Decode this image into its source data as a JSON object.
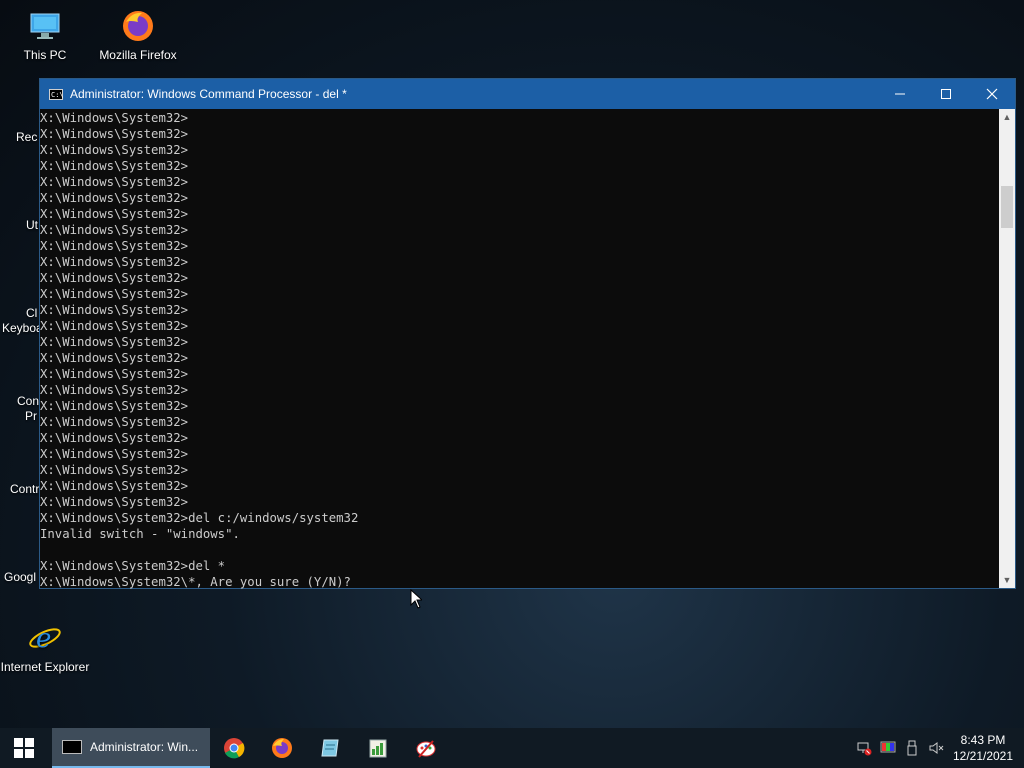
{
  "desktop": {
    "icons": [
      {
        "label": "This PC",
        "icon": "this-pc-icon"
      },
      {
        "label": "Mozilla Firefox",
        "icon": "firefox-icon"
      },
      {
        "label": "Internet Explorer",
        "icon": "internet-explorer-icon"
      }
    ],
    "partial_labels": [
      "Rec",
      "Ut",
      "Cl",
      "Keyboa",
      "Con",
      "Pr",
      "Contr",
      "Googl"
    ]
  },
  "window": {
    "title": "Administrator: Windows Command Processor - del  *",
    "minimize": "—",
    "maximize": "☐",
    "close": "✕"
  },
  "console": {
    "lines": [
      "X:\\Windows\\System32>",
      "X:\\Windows\\System32>",
      "X:\\Windows\\System32>",
      "X:\\Windows\\System32>",
      "X:\\Windows\\System32>",
      "X:\\Windows\\System32>",
      "X:\\Windows\\System32>",
      "X:\\Windows\\System32>",
      "X:\\Windows\\System32>",
      "X:\\Windows\\System32>",
      "X:\\Windows\\System32>",
      "X:\\Windows\\System32>",
      "X:\\Windows\\System32>",
      "X:\\Windows\\System32>",
      "X:\\Windows\\System32>",
      "X:\\Windows\\System32>",
      "X:\\Windows\\System32>",
      "X:\\Windows\\System32>",
      "X:\\Windows\\System32>",
      "X:\\Windows\\System32>",
      "X:\\Windows\\System32>",
      "X:\\Windows\\System32>",
      "X:\\Windows\\System32>",
      "X:\\Windows\\System32>",
      "X:\\Windows\\System32>",
      "X:\\Windows\\System32>del c:/windows/system32",
      "Invalid switch - \"windows\".",
      "",
      "X:\\Windows\\System32>del *",
      "X:\\Windows\\System32\\*, Are you sure (Y/N)?"
    ]
  },
  "taskbar": {
    "active_task": "Administrator: Win...",
    "pinned": [
      "chrome-icon",
      "firefox-icon",
      "notepad-icon",
      "spreadsheet-icon",
      "paint-icon"
    ],
    "clock": {
      "time": "8:43 PM",
      "date": "12/21/2021"
    }
  },
  "colors": {
    "titlebar": "#1c5fa6",
    "console_bg": "#0c0c0c",
    "console_fg": "#cccccc",
    "taskbar": "#101a23"
  }
}
